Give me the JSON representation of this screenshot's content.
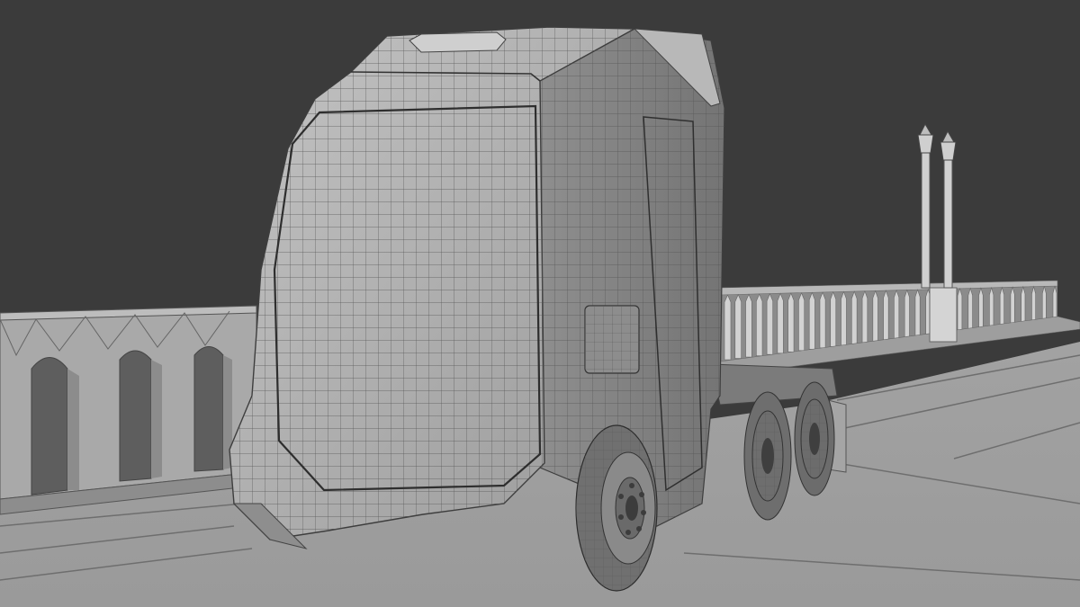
{
  "scene": {
    "subject": "truck",
    "background_color": "#3b3b3b",
    "surface_color": "#9c9c9c",
    "ground_color": "#a4a4a4",
    "wire_color": "#4a4a4a",
    "wireframe": true
  }
}
